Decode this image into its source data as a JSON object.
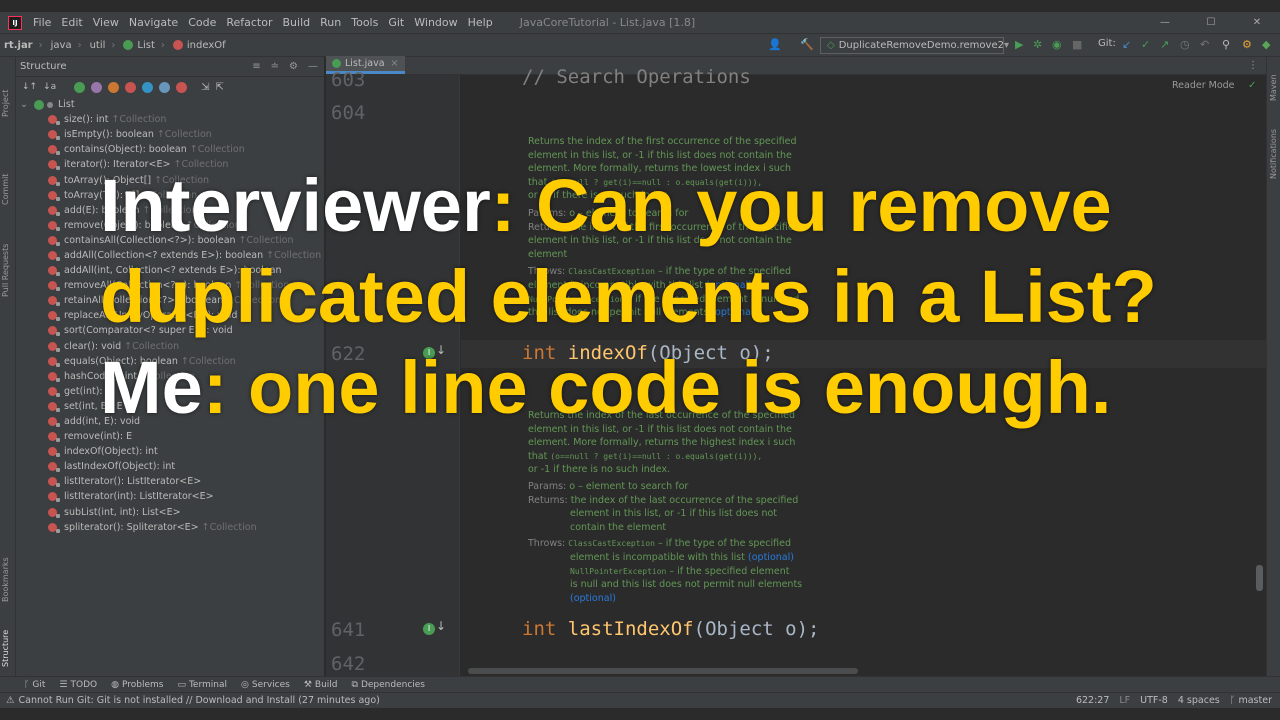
{
  "menubar": {
    "items": [
      "File",
      "Edit",
      "View",
      "Navigate",
      "Code",
      "Refactor",
      "Build",
      "Run",
      "Tools",
      "Git",
      "Window",
      "Help"
    ],
    "window_title": "JavaCoreTutorial - List.java [1.8]"
  },
  "navbar": {
    "crumbs": [
      "rt.jar",
      "java",
      "util",
      "List",
      "indexOf"
    ],
    "run_config": "DuplicateRemoveDemo.remove2",
    "git_label": "Git:"
  },
  "left_strip": {
    "project": "Project",
    "commit": "Commit",
    "pull_requests": "Pull Requests",
    "bookmarks": "Bookmarks",
    "structure": "Structure"
  },
  "right_strip": {
    "maven": "Maven",
    "notifications": "Notifications"
  },
  "structure": {
    "title": "Structure",
    "root": "List",
    "items": [
      {
        "sig": "size(): int",
        "inh": "↑Collection"
      },
      {
        "sig": "isEmpty(): boolean",
        "inh": "↑Collection"
      },
      {
        "sig": "contains(Object): boolean",
        "inh": "↑Collection"
      },
      {
        "sig": "iterator(): Iterator<E>",
        "inh": "↑Collection"
      },
      {
        "sig": "toArray(): Object[]",
        "inh": "↑Collection"
      },
      {
        "sig": "toArray(T[]): T[]",
        "inh": "↑Collection"
      },
      {
        "sig": "add(E): boolean",
        "inh": "↑Collection"
      },
      {
        "sig": "remove(Object): boolean",
        "inh": "↑Collection"
      },
      {
        "sig": "containsAll(Collection<?>): boolean",
        "inh": "↑Collection"
      },
      {
        "sig": "addAll(Collection<? extends E>): boolean",
        "inh": "↑Collection"
      },
      {
        "sig": "addAll(int, Collection<? extends E>): boolean",
        "inh": ""
      },
      {
        "sig": "removeAll(Collection<?>): boolean",
        "inh": "↑Collection"
      },
      {
        "sig": "retainAll(Collection<?>): boolean",
        "inh": "↑Collection"
      },
      {
        "sig": "replaceAll(UnaryOperator<E>): void",
        "inh": ""
      },
      {
        "sig": "sort(Comparator<? super E>): void",
        "inh": ""
      },
      {
        "sig": "clear(): void",
        "inh": "↑Collection"
      },
      {
        "sig": "equals(Object): boolean",
        "inh": "↑Collection"
      },
      {
        "sig": "hashCode(): int",
        "inh": "↑Collection"
      },
      {
        "sig": "get(int): E",
        "inh": ""
      },
      {
        "sig": "set(int, E): E",
        "inh": ""
      },
      {
        "sig": "add(int, E): void",
        "inh": ""
      },
      {
        "sig": "remove(int): E",
        "inh": ""
      },
      {
        "sig": "indexOf(Object): int",
        "inh": ""
      },
      {
        "sig": "lastIndexOf(Object): int",
        "inh": ""
      },
      {
        "sig": "listIterator(): ListIterator<E>",
        "inh": ""
      },
      {
        "sig": "listIterator(int): ListIterator<E>",
        "inh": ""
      },
      {
        "sig": "subList(int, int): List<E>",
        "inh": ""
      },
      {
        "sig": "spliterator(): Spliterator<E>",
        "inh": "↑Collection"
      }
    ]
  },
  "editor": {
    "tab": "List.java",
    "reader_mode": "Reader Mode",
    "lines": {
      "l603": "603",
      "l604": "604",
      "l622": "622",
      "l641": "641",
      "l642": "642"
    },
    "comment_603": "// Search Operations",
    "code_622": {
      "kw": "int",
      "fn": "indexOf",
      "rest": "(Object o);"
    },
    "code_641": {
      "kw": "int",
      "fn": "lastIndexOf",
      "rest": "(Object o);"
    },
    "doc1": {
      "line1": "Returns the index of the first occurrence of the specified",
      "line2": "element in this list, or -1 if this list does not contain the",
      "line3": "element. More formally, returns the lowest index i such",
      "line4a": "that",
      "line4code": "(o==null ? get(i)==null : o.equals(get(i))),",
      "line5": "or -1 if there is no such index.",
      "params_label": "Params:",
      "params": "o – element to search for",
      "returns_label": "Returns:",
      "returns": "the index of the first occurrence of the specified element in this list, or -1 if this list does not contain the element",
      "throws_label": "Throws:",
      "throws1_link": "ClassCastException",
      "throws1": "– if the type of the specified element is incompatible with this list",
      "throws1_opt": "(optional)",
      "throws2_link": "NullPointerException",
      "throws2": "– if the specified element is null and this list does not permit null elements",
      "throws2_opt": "(optional)"
    },
    "doc2": {
      "line1": "Returns the index of the last occurrence of the specified",
      "line2": "element in this list, or -1 if this list does not contain the",
      "line3": "element. More formally, returns the highest index i such",
      "line4a": "that",
      "line4code": "(o==null ? get(i)==null : o.equals(get(i))),",
      "line5": "or -1 if there is no such index.",
      "params_label": "Params:",
      "params": "o – element to search for",
      "returns_label": "Returns:",
      "returns1": "the index of the last occurrence of the specified",
      "returns2": "element in this list, or -1 if this list does not",
      "returns3": "contain the element",
      "throws_label": "Throws:",
      "throws1_link": "ClassCastException",
      "throws1a": "– if the type of the specified",
      "throws1b": "element is incompatible with this list",
      "throws1_opt": "(optional)",
      "throws2_link": "NullPointerException",
      "throws2a": "– if the specified element",
      "throws2b": "is null and this list does not permit null elements",
      "throws2_opt": "(optional)"
    }
  },
  "bottom_tools": [
    "Git",
    "TODO",
    "Problems",
    "Terminal",
    "Services",
    "Build",
    "Dependencies"
  ],
  "status": {
    "message": "Cannot Run Git: Git is not installed // Download and Install (27 minutes ago)",
    "position": "622:27",
    "line_sep": "LF",
    "encoding": "UTF-8",
    "indent": "4 spaces",
    "branch": "master"
  },
  "caption": {
    "line1_speaker": "Interviewer",
    "line1_text": ": Can you remove",
    "line2_text": "duplicated elements in a List?",
    "line3_speaker": "Me",
    "line3_text": ": one line code is enough."
  },
  "colors": {
    "accent": "#ffcc00",
    "keyword": "#cc7832",
    "function": "#ffc66d",
    "doc": "#629755",
    "background": "#2b2b2b"
  }
}
